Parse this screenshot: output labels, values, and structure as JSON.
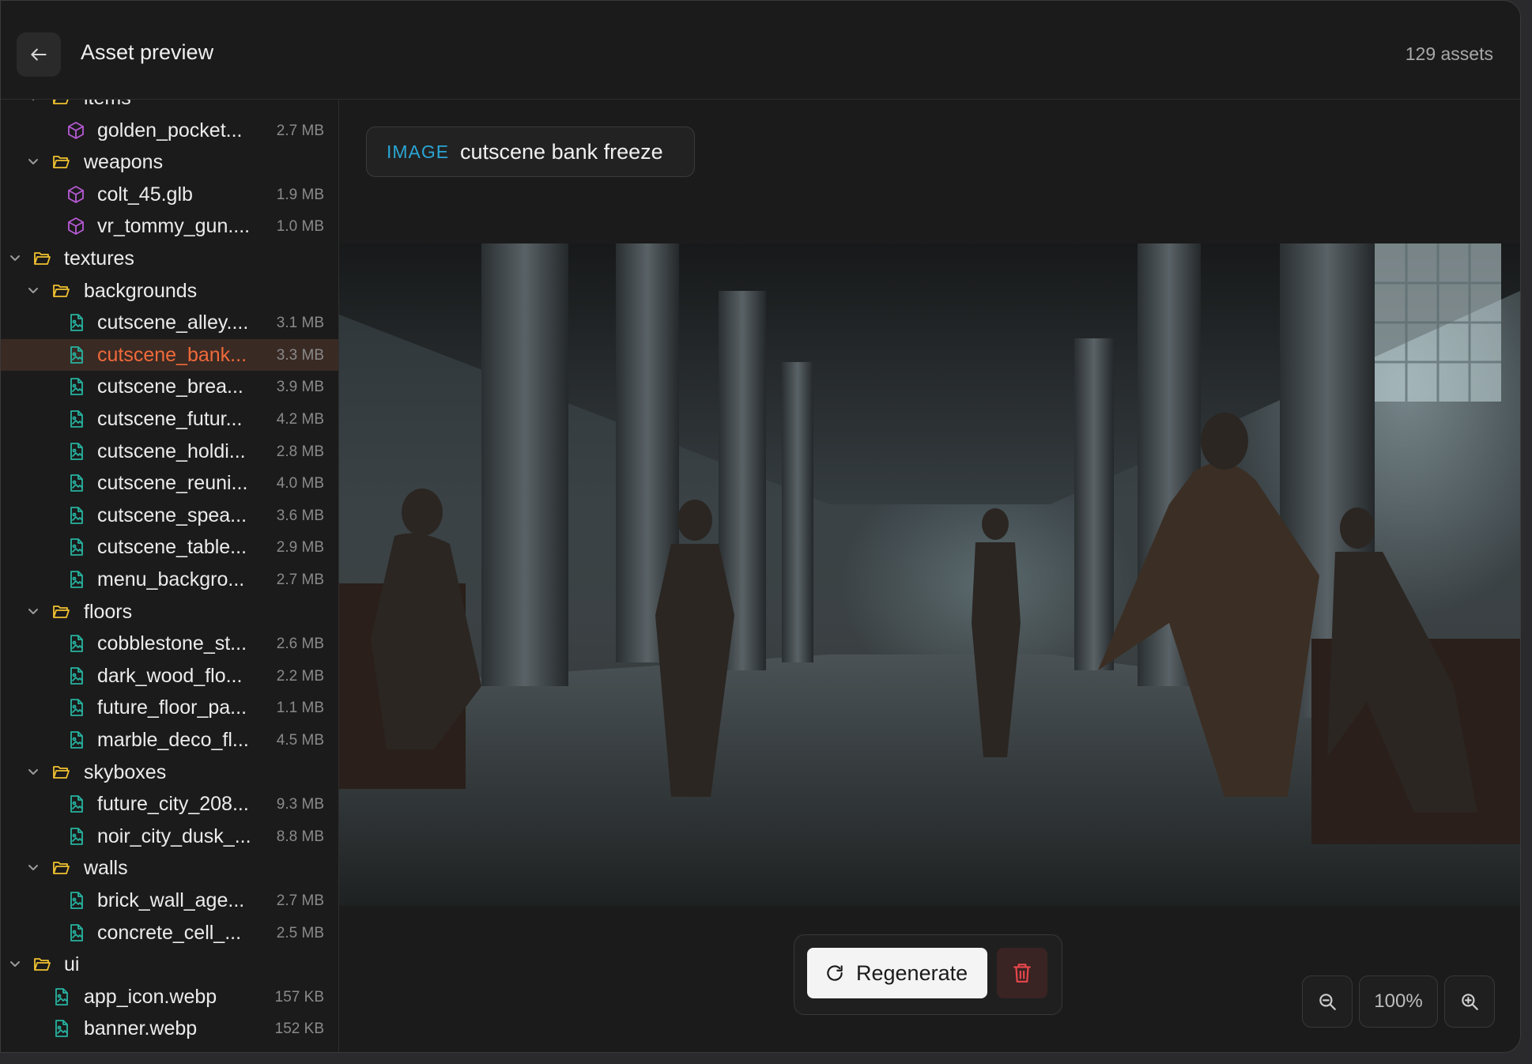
{
  "header": {
    "title": "Asset preview",
    "asset_count": "129 assets"
  },
  "tree": [
    {
      "kind": "folder",
      "depth": 1,
      "label": "items"
    },
    {
      "kind": "model",
      "depth": 2,
      "label": "golden_pocket...",
      "size": "2.7 MB"
    },
    {
      "kind": "folder",
      "depth": 1,
      "label": "weapons"
    },
    {
      "kind": "model",
      "depth": 2,
      "label": "colt_45.glb",
      "size": "1.9 MB"
    },
    {
      "kind": "model",
      "depth": 2,
      "label": "vr_tommy_gun....",
      "size": "1.0 MB"
    },
    {
      "kind": "folder",
      "depth": 0,
      "label": "textures"
    },
    {
      "kind": "folder",
      "depth": 1,
      "label": "backgrounds"
    },
    {
      "kind": "image",
      "depth": 2,
      "label": "cutscene_alley....",
      "size": "3.1 MB"
    },
    {
      "kind": "image",
      "depth": 2,
      "label": "cutscene_bank...",
      "size": "3.3 MB",
      "selected": true
    },
    {
      "kind": "image",
      "depth": 2,
      "label": "cutscene_brea...",
      "size": "3.9 MB"
    },
    {
      "kind": "image",
      "depth": 2,
      "label": "cutscene_futur...",
      "size": "4.2 MB"
    },
    {
      "kind": "image",
      "depth": 2,
      "label": "cutscene_holdi...",
      "size": "2.8 MB"
    },
    {
      "kind": "image",
      "depth": 2,
      "label": "cutscene_reuni...",
      "size": "4.0 MB"
    },
    {
      "kind": "image",
      "depth": 2,
      "label": "cutscene_spea...",
      "size": "3.6 MB"
    },
    {
      "kind": "image",
      "depth": 2,
      "label": "cutscene_table...",
      "size": "2.9 MB"
    },
    {
      "kind": "image",
      "depth": 2,
      "label": "menu_backgro...",
      "size": "2.7 MB"
    },
    {
      "kind": "folder",
      "depth": 1,
      "label": "floors"
    },
    {
      "kind": "image",
      "depth": 2,
      "label": "cobblestone_st...",
      "size": "2.6 MB"
    },
    {
      "kind": "image",
      "depth": 2,
      "label": "dark_wood_flo...",
      "size": "2.2 MB"
    },
    {
      "kind": "image",
      "depth": 2,
      "label": "future_floor_pa...",
      "size": "1.1 MB"
    },
    {
      "kind": "image",
      "depth": 2,
      "label": "marble_deco_fl...",
      "size": "4.5 MB"
    },
    {
      "kind": "folder",
      "depth": 1,
      "label": "skyboxes"
    },
    {
      "kind": "image",
      "depth": 2,
      "label": "future_city_208...",
      "size": "9.3 MB"
    },
    {
      "kind": "image",
      "depth": 2,
      "label": "noir_city_dusk_...",
      "size": "8.8 MB"
    },
    {
      "kind": "folder",
      "depth": 1,
      "label": "walls"
    },
    {
      "kind": "image",
      "depth": 2,
      "label": "brick_wall_age...",
      "size": "2.7 MB"
    },
    {
      "kind": "image",
      "depth": 2,
      "label": "concrete_cell_...",
      "size": "2.5 MB"
    },
    {
      "kind": "folder",
      "depth": 0,
      "label": "ui"
    },
    {
      "kind": "image",
      "depth": 1,
      "label": "app_icon.webp",
      "size": "157 KB"
    },
    {
      "kind": "image",
      "depth": 1,
      "label": "banner.webp",
      "size": "152 KB"
    }
  ],
  "asset": {
    "type": "IMAGE",
    "name": "cutscene bank freeze"
  },
  "actions": {
    "regenerate_label": "Regenerate"
  },
  "zoom": {
    "level": "100%"
  },
  "colors": {
    "accent_selected": "#f06a3a",
    "folder_icon": "#f2c230",
    "model_icon": "#b85ad6",
    "image_icon": "#27b3a0",
    "asset_type": "#2aa5d4",
    "delete": "#e8474b"
  }
}
